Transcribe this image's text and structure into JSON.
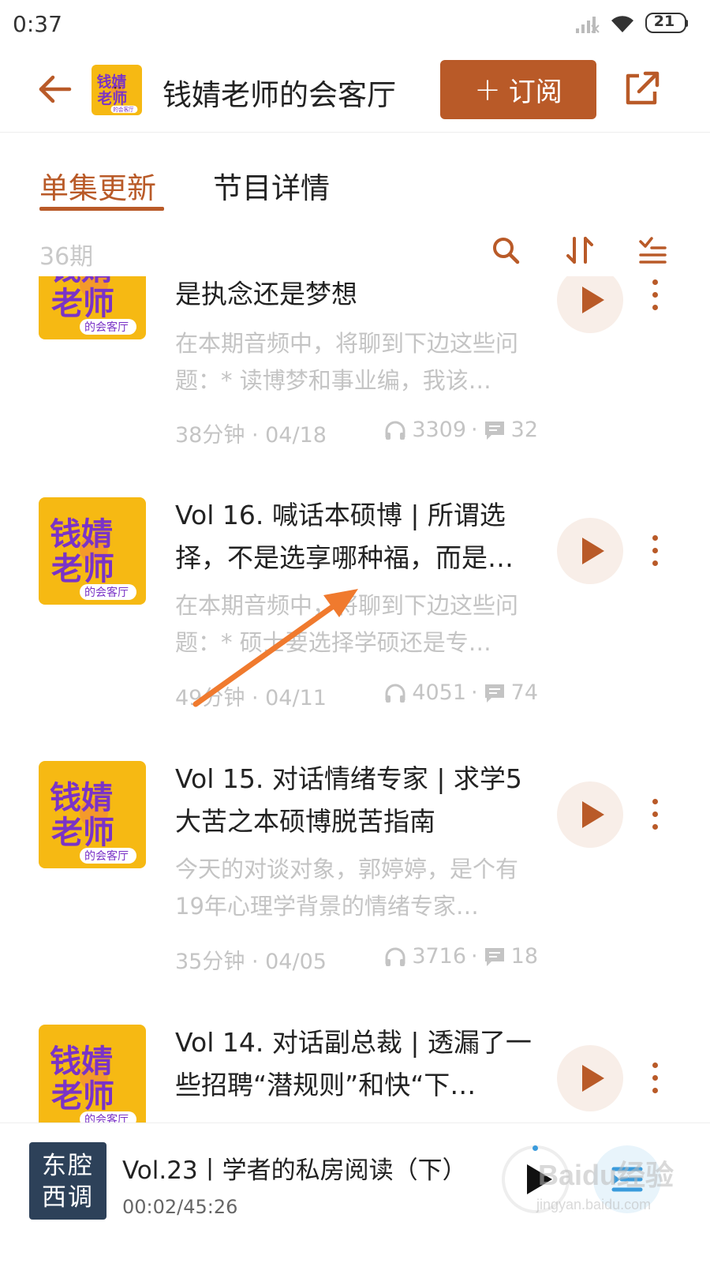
{
  "status_bar": {
    "time": "0:37",
    "battery": "21"
  },
  "header": {
    "title": "钱婧老师的会客厅",
    "subscribe_label": "订阅",
    "subscribe_plus": "+"
  },
  "cover_art": {
    "line1": "钱婧",
    "line2": "老师",
    "tag": "的会客厅"
  },
  "tabs": [
    {
      "label": "单集更新",
      "active": true
    },
    {
      "label": "节目详情",
      "active": false
    }
  ],
  "list": {
    "episode_count": "36期"
  },
  "episodes": [
    {
      "title": "是执念还是梦想",
      "description": "在本期音频中，将聊到下边这些问题：* 读博梦和事业编，我该…",
      "duration": "38分钟",
      "date": "04/18",
      "plays": "3309",
      "comments": "32"
    },
    {
      "title": "Vol 16. 喊话本硕博 | 所谓选择，不是选享哪种福，而是…",
      "description": "在本期音频中，将聊到下边这些问题：* 硕士要选择学硕还是专…",
      "duration": "49分钟",
      "date": "04/11",
      "plays": "4051",
      "comments": "74"
    },
    {
      "title": "Vol 15. 对话情绪专家 | 求学5大苦之本硕博脱苦指南",
      "description": "今天的对谈对象，郭婷婷，是个有19年心理学背景的情绪专家…",
      "duration": "35分钟",
      "date": "04/05",
      "plays": "3716",
      "comments": "18"
    },
    {
      "title": "Vol 14. 对话副总裁 | 透漏了一些招聘“潜规则”和快“下…",
      "description": "",
      "duration": "",
      "date": "",
      "plays": "",
      "comments": ""
    }
  ],
  "mini_player": {
    "cover_text_line1": "东腔",
    "cover_text_line2": "西调",
    "title": "Vol.23丨学者的私房阅读（下）",
    "time": "00:02/45:26"
  },
  "watermark": {
    "main": "Baidu经验",
    "sub": "jingyan.baidu.com"
  },
  "colors": {
    "accent": "#b95a28",
    "cover_yellow": "#f6b913",
    "cover_purple": "#7a33c7",
    "muted_text": "#c4c4c4",
    "annotation_arrow": "#f07a2e"
  }
}
